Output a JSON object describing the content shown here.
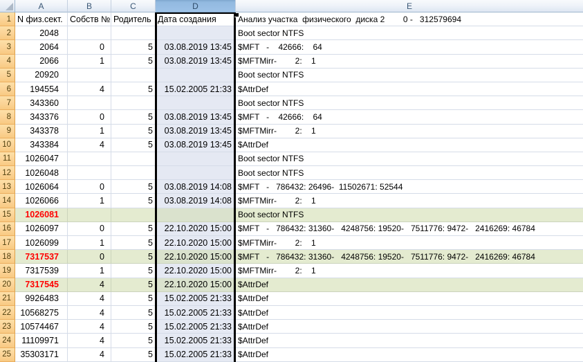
{
  "colors": {
    "selected_column_fill": "#E5E9F3",
    "selected_column_header": "#9DC2E7",
    "row_header_fill": "#FBD396",
    "highlight_row_green": "#E4EBD0",
    "highlight_row_green_in_selection": "#DAE2CD",
    "alert_text_red": "#FF0000",
    "selection_border": "#000000",
    "gridline": "#D5DCE8"
  },
  "sheet": {
    "selected_column": "D",
    "column_headers": [
      "A",
      "B",
      "C",
      "D",
      "E"
    ],
    "rows": [
      {
        "n": 1,
        "a": "N физ.сект.",
        "b": "Собств №",
        "c": "Родитель",
        "d": "Дата создания",
        "e": "Анализ участка  физического  диска 2        0 -   312579694",
        "highlight": false,
        "red": false
      },
      {
        "n": 2,
        "a": "2048",
        "b": "",
        "c": "",
        "d": "",
        "e": "Boot sector NTFS",
        "highlight": false,
        "red": false
      },
      {
        "n": 3,
        "a": "2064",
        "b": "0",
        "c": "5",
        "d": "03.08.2019 13:45",
        "e": "$MFT   -    42666:    64",
        "highlight": false,
        "red": false
      },
      {
        "n": 4,
        "a": "2066",
        "b": "1",
        "c": "5",
        "d": "03.08.2019 13:45",
        "e": "$MFTMirr-        2:    1",
        "highlight": false,
        "red": false
      },
      {
        "n": 5,
        "a": "20920",
        "b": "",
        "c": "",
        "d": "",
        "e": "Boot sector NTFS",
        "highlight": false,
        "red": false
      },
      {
        "n": 6,
        "a": "194554",
        "b": "4",
        "c": "5",
        "d": "15.02.2005 21:33",
        "e": "$AttrDef",
        "highlight": false,
        "red": false
      },
      {
        "n": 7,
        "a": "343360",
        "b": "",
        "c": "",
        "d": "",
        "e": "Boot sector NTFS",
        "highlight": false,
        "red": false
      },
      {
        "n": 8,
        "a": "343376",
        "b": "0",
        "c": "5",
        "d": "03.08.2019 13:45",
        "e": "$MFT   -    42666:    64",
        "highlight": false,
        "red": false
      },
      {
        "n": 9,
        "a": "343378",
        "b": "1",
        "c": "5",
        "d": "03.08.2019 13:45",
        "e": "$MFTMirr-        2:    1",
        "highlight": false,
        "red": false
      },
      {
        "n": 10,
        "a": "343384",
        "b": "4",
        "c": "5",
        "d": "03.08.2019 13:45",
        "e": "$AttrDef",
        "highlight": false,
        "red": false
      },
      {
        "n": 11,
        "a": "1026047",
        "b": "",
        "c": "",
        "d": "",
        "e": "Boot sector NTFS",
        "highlight": false,
        "red": false
      },
      {
        "n": 12,
        "a": "1026048",
        "b": "",
        "c": "",
        "d": "",
        "e": "Boot sector NTFS",
        "highlight": false,
        "red": false
      },
      {
        "n": 13,
        "a": "1026064",
        "b": "0",
        "c": "5",
        "d": "03.08.2019 14:08",
        "e": "$MFT   -   786432: 26496-  11502671: 52544",
        "highlight": false,
        "red": false
      },
      {
        "n": 14,
        "a": "1026066",
        "b": "1",
        "c": "5",
        "d": "03.08.2019 14:08",
        "e": "$MFTMirr-        2:    1",
        "highlight": false,
        "red": false
      },
      {
        "n": 15,
        "a": "1026081",
        "b": "",
        "c": "",
        "d": "",
        "e": "Boot sector NTFS",
        "highlight": true,
        "red": true
      },
      {
        "n": 16,
        "a": "1026097",
        "b": "0",
        "c": "5",
        "d": "22.10.2020 15:00",
        "e": "$MFT   -   786432: 31360-   4248756: 19520-   7511776: 9472-   2416269: 46784",
        "highlight": false,
        "red": false
      },
      {
        "n": 17,
        "a": "1026099",
        "b": "1",
        "c": "5",
        "d": "22.10.2020 15:00",
        "e": "$MFTMirr-        2:    1",
        "highlight": false,
        "red": false
      },
      {
        "n": 18,
        "a": "7317537",
        "b": "0",
        "c": "5",
        "d": "22.10.2020 15:00",
        "e": "$MFT   -   786432: 31360-   4248756: 19520-   7511776: 9472-   2416269: 46784",
        "highlight": true,
        "red": true
      },
      {
        "n": 19,
        "a": "7317539",
        "b": "1",
        "c": "5",
        "d": "22.10.2020 15:00",
        "e": "$MFTMirr-        2:    1",
        "highlight": false,
        "red": false
      },
      {
        "n": 20,
        "a": "7317545",
        "b": "4",
        "c": "5",
        "d": "22.10.2020 15:00",
        "e": "$AttrDef",
        "highlight": true,
        "red": true
      },
      {
        "n": 21,
        "a": "9926483",
        "b": "4",
        "c": "5",
        "d": "15.02.2005 21:33",
        "e": "$AttrDef",
        "highlight": false,
        "red": false
      },
      {
        "n": 22,
        "a": "10568275",
        "b": "4",
        "c": "5",
        "d": "15.02.2005 21:33",
        "e": "$AttrDef",
        "highlight": false,
        "red": false
      },
      {
        "n": 23,
        "a": "10574467",
        "b": "4",
        "c": "5",
        "d": "15.02.2005 21:33",
        "e": "$AttrDef",
        "highlight": false,
        "red": false
      },
      {
        "n": 24,
        "a": "11109971",
        "b": "4",
        "c": "5",
        "d": "15.02.2005 21:33",
        "e": "$AttrDef",
        "highlight": false,
        "red": false
      },
      {
        "n": 25,
        "a": "35303171",
        "b": "4",
        "c": "5",
        "d": "15.02.2005 21:33",
        "e": "$AttrDef",
        "highlight": false,
        "red": false
      }
    ]
  }
}
